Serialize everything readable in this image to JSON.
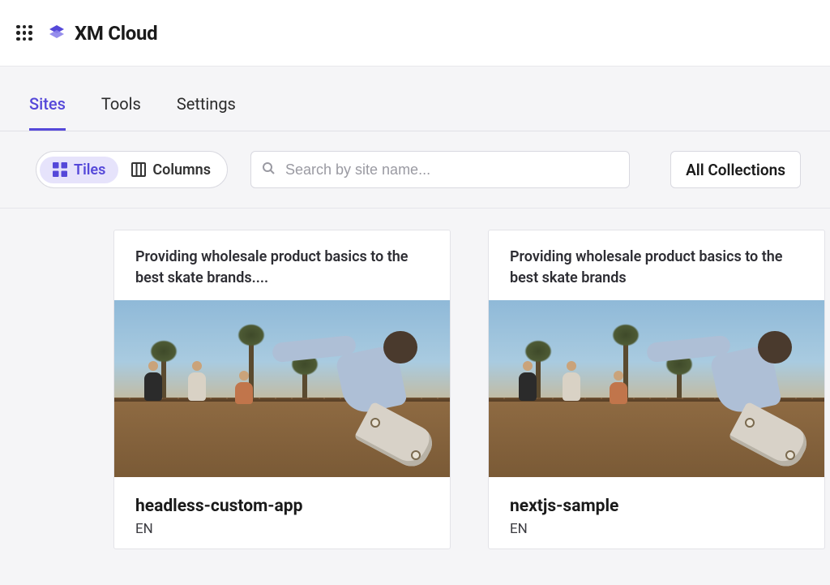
{
  "header": {
    "product_name": "XM Cloud"
  },
  "tabs": {
    "sites": "Sites",
    "tools": "Tools",
    "settings": "Settings",
    "active": "sites"
  },
  "toolbar": {
    "view_tiles": "Tiles",
    "view_columns": "Columns",
    "search_placeholder": "Search by site name...",
    "collections_label": "All Collections"
  },
  "sites": [
    {
      "description": "Providing wholesale product basics to the best skate brands....",
      "name": "headless-custom-app",
      "language": "EN"
    },
    {
      "description": "Providing wholesale product basics to the best skate brands",
      "name": "nextjs-sample",
      "language": "EN"
    }
  ]
}
